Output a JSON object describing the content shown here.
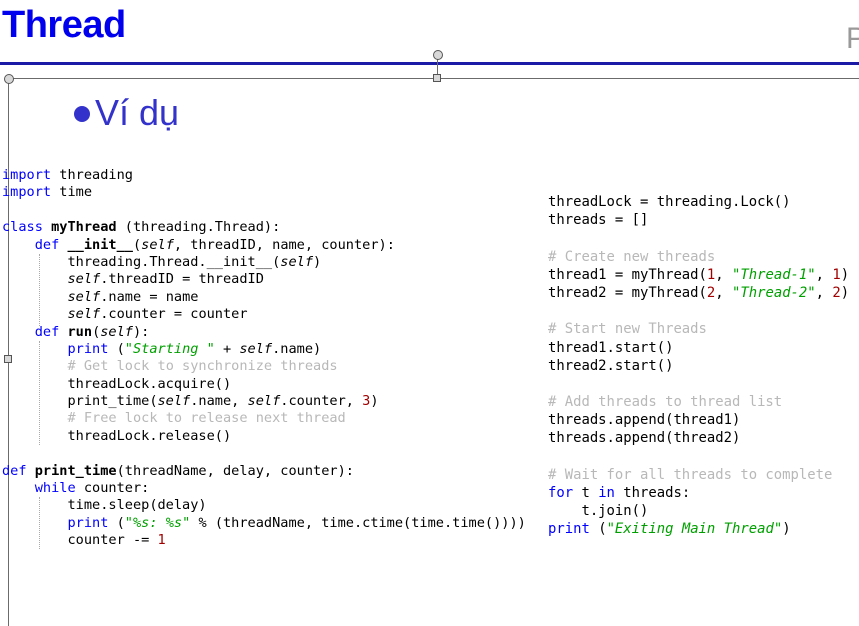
{
  "slide": {
    "title": "Thread",
    "corner_letter": "P",
    "bullet_text": "Ví dụ"
  },
  "code_left": [
    {
      "segs": [
        {
          "t": "import",
          "c": "kw"
        },
        {
          "t": " threading"
        }
      ]
    },
    {
      "segs": [
        {
          "t": "import",
          "c": "kw"
        },
        {
          "t": " time"
        }
      ]
    },
    {
      "segs": [
        {
          "t": ""
        }
      ]
    },
    {
      "segs": [
        {
          "t": "class",
          "c": "kw"
        },
        {
          "t": " "
        },
        {
          "t": "myThread",
          "c": "fn"
        },
        {
          "t": " (threading.Thread):"
        }
      ]
    },
    {
      "segs": [
        {
          "t": "    "
        },
        {
          "t": "def",
          "c": "kw"
        },
        {
          "t": " "
        },
        {
          "t": "__init__",
          "c": "fn"
        },
        {
          "t": "("
        },
        {
          "t": "self",
          "c": "self"
        },
        {
          "t": ", threadID, name, counter):"
        }
      ]
    },
    {
      "segs": [
        {
          "t": "        threading.Thread.__init__("
        },
        {
          "t": "self",
          "c": "self"
        },
        {
          "t": ")"
        }
      ]
    },
    {
      "segs": [
        {
          "t": "        "
        },
        {
          "t": "self",
          "c": "self"
        },
        {
          "t": ".threadID = threadID"
        }
      ]
    },
    {
      "segs": [
        {
          "t": "        "
        },
        {
          "t": "self",
          "c": "self"
        },
        {
          "t": ".name = name"
        }
      ]
    },
    {
      "segs": [
        {
          "t": "        "
        },
        {
          "t": "self",
          "c": "self"
        },
        {
          "t": ".counter = counter"
        }
      ]
    },
    {
      "segs": [
        {
          "t": "    "
        },
        {
          "t": "def",
          "c": "kw"
        },
        {
          "t": " "
        },
        {
          "t": "run",
          "c": "fn"
        },
        {
          "t": "("
        },
        {
          "t": "self",
          "c": "self"
        },
        {
          "t": "):"
        }
      ]
    },
    {
      "segs": [
        {
          "t": "        "
        },
        {
          "t": "print",
          "c": "kw"
        },
        {
          "t": " ("
        },
        {
          "t": "\"Starting \"",
          "c": "str"
        },
        {
          "t": " + "
        },
        {
          "t": "self",
          "c": "self"
        },
        {
          "t": ".name)"
        }
      ]
    },
    {
      "segs": [
        {
          "t": "        "
        },
        {
          "t": "# Get lock to synchronize threads",
          "c": "cmt"
        }
      ]
    },
    {
      "segs": [
        {
          "t": "        threadLock.acquire()"
        }
      ]
    },
    {
      "segs": [
        {
          "t": "        print_time("
        },
        {
          "t": "self",
          "c": "self"
        },
        {
          "t": ".name, "
        },
        {
          "t": "self",
          "c": "self"
        },
        {
          "t": ".counter, "
        },
        {
          "t": "3",
          "c": "num"
        },
        {
          "t": ")"
        }
      ]
    },
    {
      "segs": [
        {
          "t": "        "
        },
        {
          "t": "# Free lock to release next thread",
          "c": "cmt"
        }
      ]
    },
    {
      "segs": [
        {
          "t": "        threadLock.release()"
        }
      ]
    },
    {
      "segs": [
        {
          "t": ""
        }
      ]
    },
    {
      "segs": [
        {
          "t": "def",
          "c": "kw"
        },
        {
          "t": " "
        },
        {
          "t": "print_time",
          "c": "fn"
        },
        {
          "t": "(threadName, delay, counter):"
        }
      ]
    },
    {
      "segs": [
        {
          "t": "    "
        },
        {
          "t": "while",
          "c": "kw"
        },
        {
          "t": " counter:"
        }
      ]
    },
    {
      "segs": [
        {
          "t": "        time.sleep(delay)"
        }
      ]
    },
    {
      "segs": [
        {
          "t": "        "
        },
        {
          "t": "print",
          "c": "kw"
        },
        {
          "t": " ("
        },
        {
          "t": "\"%s: %s\"",
          "c": "str"
        },
        {
          "t": " % (threadName, time.ctime(time.time())))"
        }
      ]
    },
    {
      "segs": [
        {
          "t": "        counter -= "
        },
        {
          "t": "1",
          "c": "num"
        }
      ]
    }
  ],
  "code_right": [
    {
      "segs": [
        {
          "t": "threadLock = threading.Lock()"
        }
      ]
    },
    {
      "segs": [
        {
          "t": "threads = []"
        }
      ]
    },
    {
      "segs": [
        {
          "t": ""
        }
      ]
    },
    {
      "segs": [
        {
          "t": "# Create new threads",
          "c": "cmt"
        }
      ]
    },
    {
      "segs": [
        {
          "t": "thread1 = myThread("
        },
        {
          "t": "1",
          "c": "num"
        },
        {
          "t": ", "
        },
        {
          "t": "\"Thread-1\"",
          "c": "str"
        },
        {
          "t": ", "
        },
        {
          "t": "1",
          "c": "num"
        },
        {
          "t": ")"
        }
      ]
    },
    {
      "segs": [
        {
          "t": "thread2 = myThread("
        },
        {
          "t": "2",
          "c": "num"
        },
        {
          "t": ", "
        },
        {
          "t": "\"Thread-2\"",
          "c": "str"
        },
        {
          "t": ", "
        },
        {
          "t": "2",
          "c": "num"
        },
        {
          "t": ")"
        }
      ]
    },
    {
      "segs": [
        {
          "t": ""
        }
      ]
    },
    {
      "segs": [
        {
          "t": "# Start new Threads",
          "c": "cmt"
        }
      ]
    },
    {
      "segs": [
        {
          "t": "thread1.start()"
        }
      ]
    },
    {
      "segs": [
        {
          "t": "thread2.start()"
        }
      ]
    },
    {
      "segs": [
        {
          "t": ""
        }
      ]
    },
    {
      "segs": [
        {
          "t": "# Add threads to thread list",
          "c": "cmt"
        }
      ]
    },
    {
      "segs": [
        {
          "t": "threads.append(thread1)"
        }
      ]
    },
    {
      "segs": [
        {
          "t": "threads.append(thread2)"
        }
      ]
    },
    {
      "segs": [
        {
          "t": ""
        }
      ]
    },
    {
      "segs": [
        {
          "t": "# Wait for all threads to complete",
          "c": "cmt"
        }
      ]
    },
    {
      "segs": [
        {
          "t": "for",
          "c": "kw"
        },
        {
          "t": " t "
        },
        {
          "t": "in",
          "c": "kw"
        },
        {
          "t": " threads:"
        }
      ]
    },
    {
      "segs": [
        {
          "t": "    t.join()"
        }
      ]
    },
    {
      "segs": [
        {
          "t": "print",
          "c": "kw"
        },
        {
          "t": " ("
        },
        {
          "t": "\"Exiting Main Thread\"",
          "c": "str"
        },
        {
          "t": ")"
        }
      ]
    }
  ],
  "colors": {
    "title": "#0000ee",
    "keyword": "#0000ff",
    "string": "#00a000",
    "comment": "#b8b8b8",
    "number": "#a00000"
  }
}
